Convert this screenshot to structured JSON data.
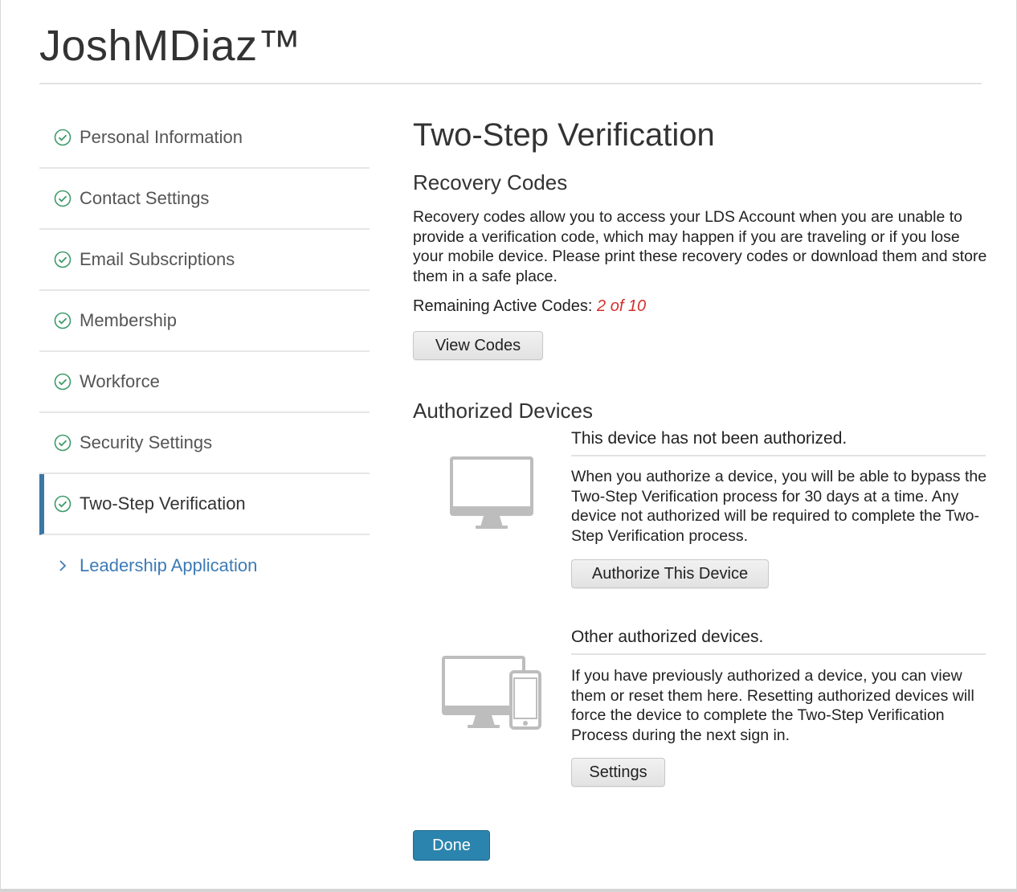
{
  "header": {
    "brand": "JoshMDiaz™"
  },
  "sidebar": {
    "items": [
      {
        "label": "Personal Information",
        "state": "complete"
      },
      {
        "label": "Contact Settings",
        "state": "complete"
      },
      {
        "label": "Email Subscriptions",
        "state": "complete"
      },
      {
        "label": "Membership",
        "state": "complete"
      },
      {
        "label": "Workforce",
        "state": "complete"
      },
      {
        "label": "Security Settings",
        "state": "complete"
      },
      {
        "label": "Two-Step Verification",
        "state": "active"
      },
      {
        "label": "Leadership Application",
        "state": "link"
      }
    ]
  },
  "main": {
    "title": "Two-Step Verification",
    "recovery": {
      "title": "Recovery Codes",
      "description": "Recovery codes allow you to access your LDS Account when you are unable to provide a verification code, which may happen if you are traveling or if you lose your mobile device. Please print these recovery codes or download them and store them in a safe place.",
      "remaining_label": "Remaining Active Codes:",
      "remaining_value": "2 of 10",
      "view_button": "View Codes"
    },
    "devices": {
      "title": "Authorized Devices",
      "this_device": {
        "heading": "This device has not been authorized.",
        "description": "When you authorize a device, you will be able to bypass the Two-Step Verification process for 30 days at a time. Any device not authorized will be required to complete the Two-Step Verification process.",
        "button": "Authorize This Device",
        "icon": "monitor-icon"
      },
      "other_devices": {
        "heading": "Other authorized devices.",
        "description": "If you have previously authorized a device, you can view them or reset them here. Resetting authorized devices will force the device to complete the Two-Step Verification Process during the next sign in.",
        "button": "Settings",
        "icon": "monitor-and-phone-icon"
      }
    },
    "done_button": "Done"
  },
  "colors": {
    "accent": "#3a77a5",
    "check_green": "#3d9a6a",
    "link_blue": "#3d7bb6",
    "remaining_red": "#d0312d",
    "primary_button": "#2b84ad"
  }
}
